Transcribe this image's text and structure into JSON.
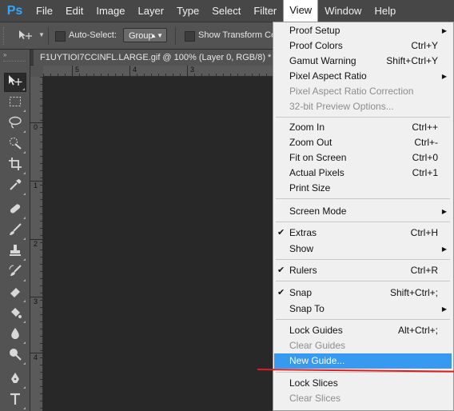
{
  "app": {
    "logo": "Ps",
    "accent": "#31a8ff"
  },
  "menubar": {
    "items": [
      "File",
      "Edit",
      "Image",
      "Layer",
      "Type",
      "Select",
      "Filter",
      "View",
      "Window",
      "Help"
    ],
    "active": "View"
  },
  "options": {
    "tool_icon": "move-tool-icon",
    "auto_select_label": "Auto-Select:",
    "auto_select_checked": false,
    "group_value": "Group",
    "show_transform_label": "Show Transform Con",
    "show_transform_checked": false
  },
  "toolbar": {
    "collapse": "»",
    "tools": [
      "move",
      "rectangular-marquee",
      "lasso",
      "quick-selection",
      "crop",
      "eyedropper",
      "spot-healing-brush",
      "brush",
      "clone-stamp",
      "history-brush",
      "eraser",
      "gradient",
      "blur",
      "dodge",
      "pen",
      "type"
    ],
    "selected": "move"
  },
  "document": {
    "tab_title": "F1UYTIOI7CCINFL.LARGE.gif @ 100% (Layer 0, RGB/8) *",
    "close_glyph": "×",
    "hruler_labels": [
      "5",
      "4",
      "3"
    ],
    "vruler_labels": [
      "0",
      "1",
      "2",
      "3",
      "4"
    ]
  },
  "view_menu": {
    "items": [
      {
        "label": "Proof Setup",
        "shortcut": "",
        "submenu": true,
        "checked": false,
        "disabled": false
      },
      {
        "label": "Proof Colors",
        "shortcut": "Ctrl+Y",
        "submenu": false,
        "checked": false,
        "disabled": false
      },
      {
        "label": "Gamut Warning",
        "shortcut": "Shift+Ctrl+Y",
        "submenu": false,
        "checked": false,
        "disabled": false
      },
      {
        "label": "Pixel Aspect Ratio",
        "shortcut": "",
        "submenu": true,
        "checked": false,
        "disabled": false
      },
      {
        "label": "Pixel Aspect Ratio Correction",
        "shortcut": "",
        "submenu": false,
        "checked": false,
        "disabled": true
      },
      {
        "label": "32-bit Preview Options...",
        "shortcut": "",
        "submenu": false,
        "checked": false,
        "disabled": true
      },
      {
        "label": "Zoom In",
        "shortcut": "Ctrl++",
        "submenu": false,
        "checked": false,
        "disabled": false
      },
      {
        "label": "Zoom Out",
        "shortcut": "Ctrl+-",
        "submenu": false,
        "checked": false,
        "disabled": false
      },
      {
        "label": "Fit on Screen",
        "shortcut": "Ctrl+0",
        "submenu": false,
        "checked": false,
        "disabled": false
      },
      {
        "label": "Actual Pixels",
        "shortcut": "Ctrl+1",
        "submenu": false,
        "checked": false,
        "disabled": false
      },
      {
        "label": "Print Size",
        "shortcut": "",
        "submenu": false,
        "checked": false,
        "disabled": false
      },
      {
        "label": "Screen Mode",
        "shortcut": "",
        "submenu": true,
        "checked": false,
        "disabled": false
      },
      {
        "label": "Extras",
        "shortcut": "Ctrl+H",
        "submenu": false,
        "checked": true,
        "disabled": false
      },
      {
        "label": "Show",
        "shortcut": "",
        "submenu": true,
        "checked": false,
        "disabled": false
      },
      {
        "label": "Rulers",
        "shortcut": "Ctrl+R",
        "submenu": false,
        "checked": true,
        "disabled": false
      },
      {
        "label": "Snap",
        "shortcut": "Shift+Ctrl+;",
        "submenu": false,
        "checked": true,
        "disabled": false
      },
      {
        "label": "Snap To",
        "shortcut": "",
        "submenu": true,
        "checked": false,
        "disabled": false
      },
      {
        "label": "Lock Guides",
        "shortcut": "Alt+Ctrl+;",
        "submenu": false,
        "checked": false,
        "disabled": false
      },
      {
        "label": "Clear Guides",
        "shortcut": "",
        "submenu": false,
        "checked": false,
        "disabled": true
      },
      {
        "label": "New Guide...",
        "shortcut": "",
        "submenu": false,
        "checked": false,
        "disabled": false,
        "highlighted": true
      },
      {
        "label": "Lock Slices",
        "shortcut": "",
        "submenu": false,
        "checked": false,
        "disabled": false
      },
      {
        "label": "Clear Slices",
        "shortcut": "",
        "submenu": false,
        "checked": false,
        "disabled": true
      }
    ],
    "check_glyph": "✔",
    "submenu_glyph": "▶",
    "highlight_color": "#3799ef",
    "annotation_color": "#e21b1b"
  }
}
